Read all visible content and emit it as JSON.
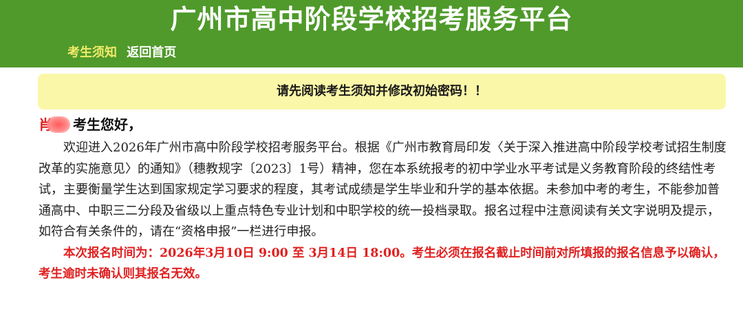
{
  "header": {
    "title": "广州市高中阶段学校招考服务平台",
    "nav": {
      "notice_label": "考生须知",
      "home_label": "返回首页"
    }
  },
  "alert": {
    "text": "请先阅读考生须知并修改初始密码！！"
  },
  "greeting": {
    "student_name": "肖",
    "suffix": "考生您好，"
  },
  "content": {
    "intro": "欢迎进入2026年广州市高中阶段学校招考服务平台。根据《广州市教育局印发〈关于深入推进高中阶段学校考试招生制度改革的实施意见〉的通知》（穗教规字〔2023〕1号）精神，您在本系统报考的初中学业水平考试是义务教育阶段的终结性考试，主要衡量学生达到国家规定学习要求的程度，其考试成绩是学生毕业和升学的基本依据。未参加中考的考生，不能参加普通高中、中职三二分段及省级以上重点特色专业计划和中职学校的统一投档录取。报名过程中注意阅读有关文字说明及提示，如符合有关条件的，请在“资格申报”一栏进行申报。",
    "notice": "本次报名时间为：2026年3月10日 9:00 至 3月14日 18:00。考生必须在报名截止时间前对所填报的报名信息予以确认，考生逾时未确认则其报名无效。"
  },
  "colors": {
    "header_bg": "#4f9a2b",
    "nav_notice": "#f2ea6a",
    "alert_bg": "#fbf7a8",
    "notice_red": "#e02020"
  }
}
